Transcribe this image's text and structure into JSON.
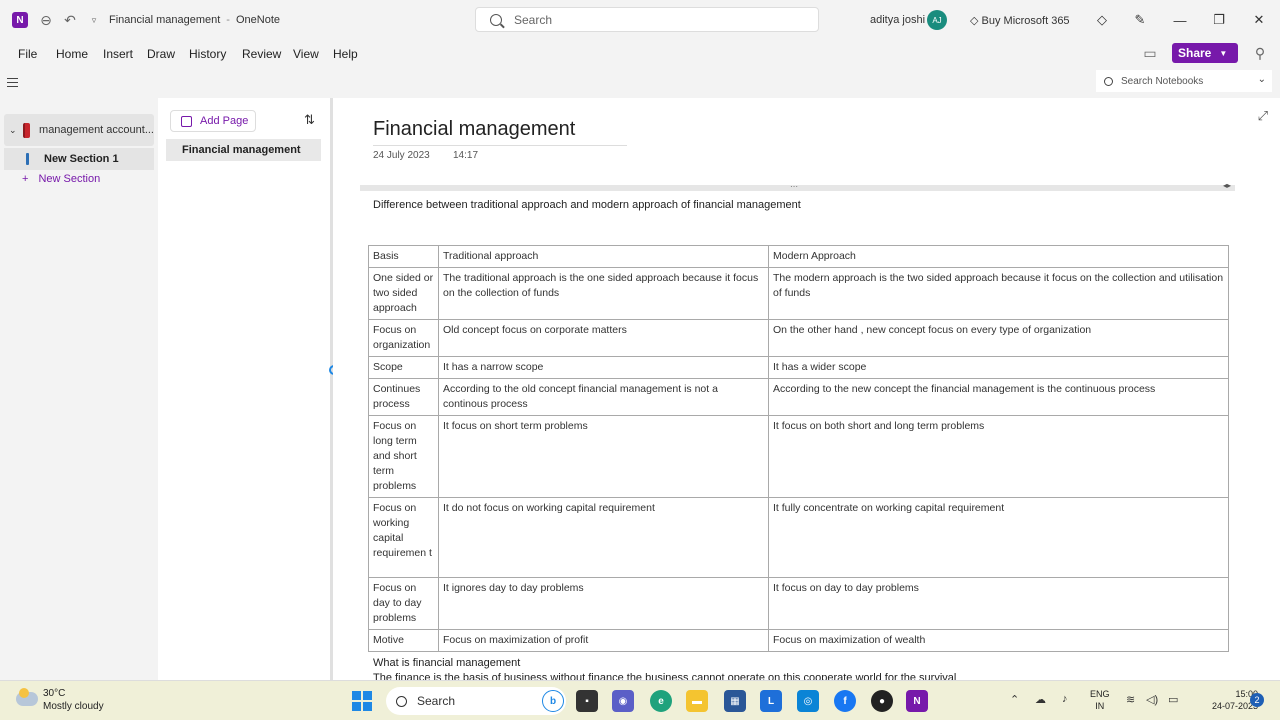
{
  "titlebar": {
    "app_icon": "onenote-logo",
    "document_title": "Financial management",
    "separator": "-",
    "app_name": "OneNote",
    "search_placeholder": "Search",
    "user_name": "aditya joshi",
    "user_initials": "AJ",
    "buy_label": "Buy Microsoft 365"
  },
  "menu": {
    "items": [
      "File",
      "Home",
      "Insert",
      "Draw",
      "History",
      "Review",
      "View",
      "Help"
    ],
    "share_label": "Share"
  },
  "toolbar": {
    "search_notebooks_placeholder": "Search Notebooks"
  },
  "notebook_pane": {
    "notebook_name": "management account...",
    "section_name": "New Section 1",
    "new_section_label": "New Section"
  },
  "page_pane": {
    "add_page_label": "Add Page",
    "pages": [
      "Financial management"
    ]
  },
  "page": {
    "title": "Financial management",
    "date": "24 July 2023",
    "time": "14:17",
    "heading": "Difference between traditional approach and modern approach of financial management",
    "table": {
      "headers": [
        "Basis",
        "Traditional approach",
        "Modern Approach"
      ],
      "rows": [
        [
          "One sided or two sided approach",
          "The traditional approach is the one sided approach because it focus on the collection of funds",
          "The modern approach is the two sided approach because it focus on the collection and utilisation of funds"
        ],
        [
          "Focus on organization",
          "Old concept focus on corporate matters",
          "On the other hand , new concept focus on every type of organization"
        ],
        [
          "Scope",
          "It has a narrow scope",
          "It has a wider scope"
        ],
        [
          "Continues process",
          "According to the old concept financial management is not a continous process",
          "According to the new concept the financial management is the continuous process"
        ],
        [
          "Focus on long term and short term problems",
          "It focus on short term problems",
          "It  focus on both short and long term problems"
        ],
        [
          "Focus on working capital requiremen t",
          "It do not focus on working capital requirement",
          "It fully concentrate on working capital requirement"
        ],
        [
          "Focus on day to day problems",
          "It ignores day to day problems",
          "It focus on day to day problems"
        ],
        [
          "Motive",
          "Focus on maximization of profit",
          "Focus on maximization of wealth"
        ]
      ]
    },
    "footer_heading": "What is financial management",
    "footer_text": "The finance is the basis of business without finance the business cannot operate on this cooperate world for the survival"
  },
  "taskbar": {
    "temperature": "30°C",
    "condition": "Mostly cloudy",
    "search_label": "Search",
    "language_line1": "ENG",
    "language_line2": "IN",
    "time": "15:00",
    "date": "24-07-2023",
    "notification_count": "2"
  }
}
